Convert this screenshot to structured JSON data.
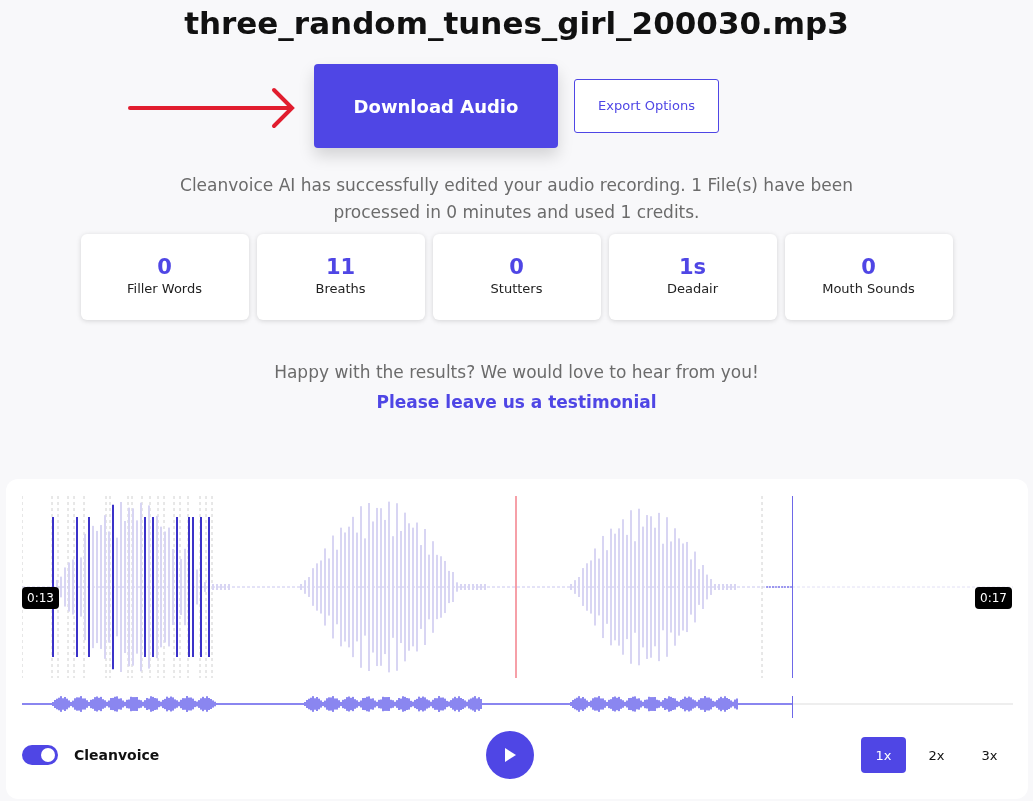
{
  "title": "three_random_tunes_girl_200030.mp3",
  "buttons": [
    {
      "label": "Download Audio",
      "kind": "primary"
    },
    {
      "label": "Export Options",
      "kind": "outline"
    }
  ],
  "message": "Cleanvoice AI has successfully edited your audio recording. 1 File(s) have been processed in 0 minutes and used 1 credits.",
  "stats": [
    {
      "value": "0",
      "label": "Filler Words"
    },
    {
      "value": "11",
      "label": "Breaths"
    },
    {
      "value": "0",
      "label": "Stutters"
    },
    {
      "value": "1s",
      "label": "Deadair"
    },
    {
      "value": "0",
      "label": "Mouth Sounds"
    }
  ],
  "feedback": {
    "text": "Happy with the results? We would love to hear from you!",
    "link": "Please leave us a testimonial"
  },
  "player": {
    "start_time": "0:13",
    "end_time": "0:17",
    "toggle": {
      "label": "Cleanvoice",
      "on": true
    },
    "speeds": [
      {
        "label": "1x",
        "selected": true
      },
      {
        "label": "2x",
        "selected": false
      },
      {
        "label": "3x",
        "selected": false
      }
    ]
  }
}
